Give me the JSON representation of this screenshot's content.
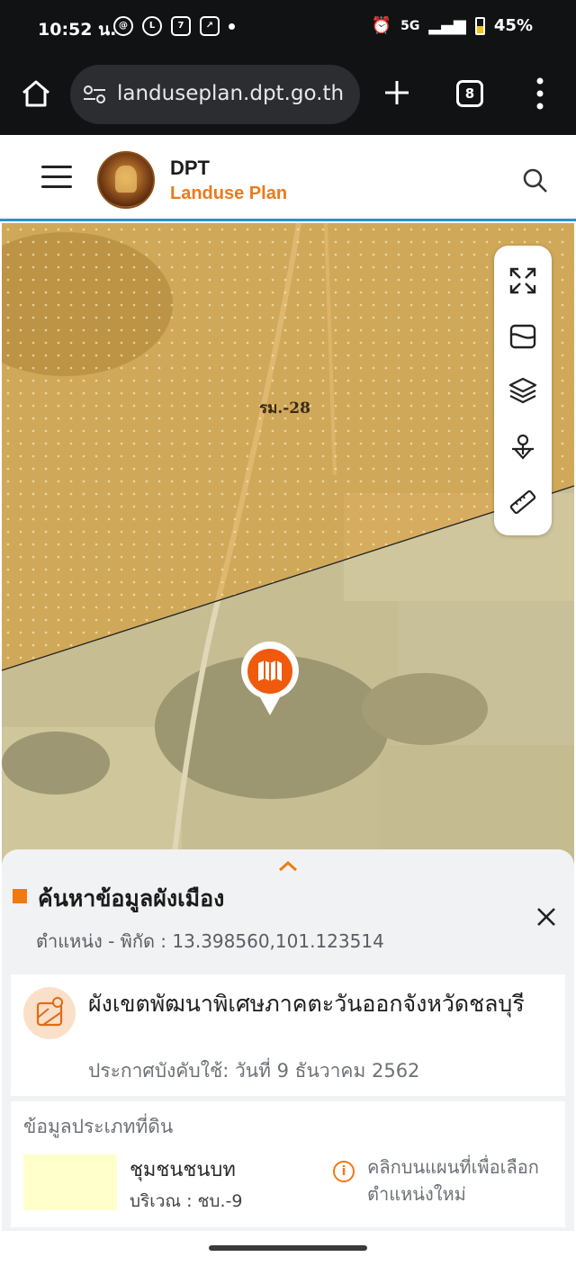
{
  "status_bar": {
    "time": "10:52 น.",
    "network": "5G",
    "battery": "45%",
    "icons": [
      "threads-icon",
      "line-icon",
      "seven-eleven-icon",
      "app-icon",
      "alarm-icon",
      "volte-icon",
      "signal-icon",
      "battery-icon"
    ]
  },
  "browser": {
    "url": "landuseplan.dpt.go.th",
    "tab_count": "8"
  },
  "site": {
    "brand_title": "DPT",
    "brand_subtitle": "Landuse Plan"
  },
  "map": {
    "zone_label": "รม.-28",
    "tools": [
      "fullscreen-icon",
      "basemap-icon",
      "layers-icon",
      "location-search-icon",
      "measure-ruler-icon"
    ]
  },
  "panel": {
    "title": "ค้นหาข้อมูลผังเมือง",
    "coordinates": "ตำแหน่ง - พิกัด : 13.398560,101.123514",
    "plan_name": "ผังเขตพัฒนาพิเศษภาคตะวันออกจังหวัดชลบุรี",
    "plan_effective": "ประกาศบังคับใช้: วันที่ 9 ธันวาคม 2562",
    "land_section_title": "ข้อมูลประเภทที่ดิน",
    "land_type": "ชุมชนชนบท",
    "land_zone": "บริเวณ : ชบ.-9",
    "hint": "คลิกบนแผนที่เพื่อเลือกตำแหน่งใหม่",
    "swatch_color": "#ffffcc",
    "accent_color": "#f07a12"
  }
}
